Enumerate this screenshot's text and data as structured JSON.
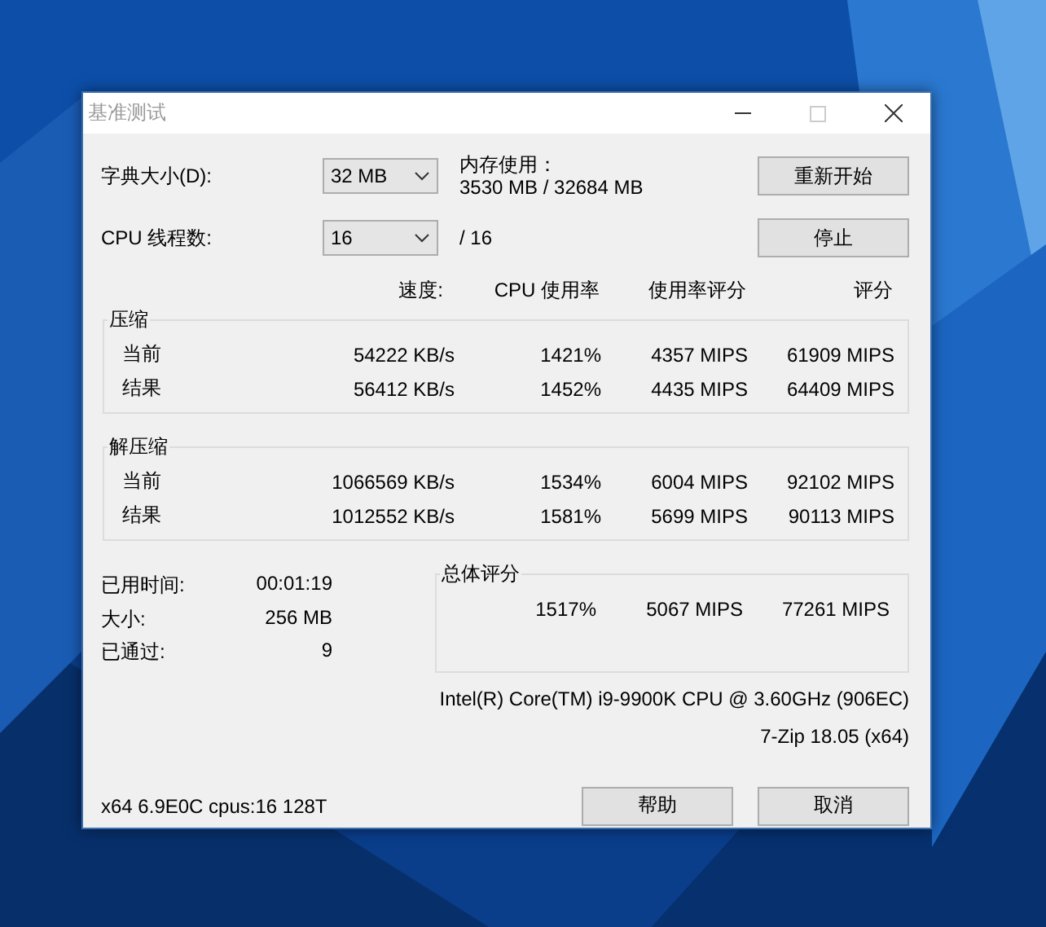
{
  "window": {
    "title": "基准测试"
  },
  "settings": [
    {
      "label": "字典大小(D):",
      "value": "32 MB"
    },
    {
      "label": "CPU 线程数:",
      "value": "16"
    }
  ],
  "memory": {
    "label": "内存使用：",
    "value": "3530 MB / 32684 MB"
  },
  "threads_total": "/ 16",
  "action_buttons": [
    "重新开始",
    "停止"
  ],
  "columns": [
    "速度:",
    "CPU 使用率",
    "使用率评分",
    "评分"
  ],
  "groups": [
    {
      "title": "压缩",
      "rows": [
        {
          "label": "当前",
          "cells": [
            "54222 KB/s",
            "1421%",
            "4357 MIPS",
            "61909 MIPS"
          ]
        },
        {
          "label": "结果",
          "cells": [
            "56412 KB/s",
            "1452%",
            "4435 MIPS",
            "64409 MIPS"
          ]
        }
      ]
    },
    {
      "title": "解压缩",
      "rows": [
        {
          "label": "当前",
          "cells": [
            "1066569 KB/s",
            "1534%",
            "6004 MIPS",
            "92102 MIPS"
          ]
        },
        {
          "label": "结果",
          "cells": [
            "1012552 KB/s",
            "1581%",
            "5699 MIPS",
            "90113 MIPS"
          ]
        }
      ]
    }
  ],
  "stats": [
    {
      "label": "已用时间:",
      "value": "00:01:19"
    },
    {
      "label": "大小:",
      "value": "256 MB"
    },
    {
      "label": "已通过:",
      "value": "9"
    }
  ],
  "total": {
    "title": "总体评分",
    "cells": [
      "1517%",
      "5067 MIPS",
      "77261 MIPS"
    ]
  },
  "cpu_info": "Intel(R) Core(TM) i9-9900K CPU @ 3.60GHz (906EC)",
  "version": "7-Zip 18.05 (x64)",
  "build_info": "x64 6.9E0C cpus:16 128T",
  "footer_buttons": [
    "帮助",
    "取消"
  ]
}
